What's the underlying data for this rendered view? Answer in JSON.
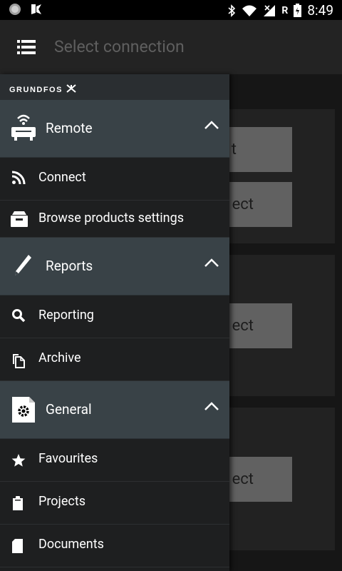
{
  "status_bar": {
    "time": "8:49",
    "network_badge": "R"
  },
  "app_bar": {
    "title": "Select connection"
  },
  "background": {
    "buttons": [
      {
        "label": "t"
      },
      {
        "label": "ect"
      },
      {
        "label": "ect"
      },
      {
        "label": "ect"
      }
    ]
  },
  "drawer": {
    "logo": "GRUNDFOS",
    "sections": [
      {
        "label": "Remote",
        "items": [
          {
            "label": "Connect",
            "icon": "rss-feed-icon"
          },
          {
            "label": "Browse products settings",
            "icon": "file-drawer-icon"
          }
        ]
      },
      {
        "label": "Reports",
        "items": [
          {
            "label": "Reporting",
            "icon": "search-icon"
          },
          {
            "label": "Archive",
            "icon": "archive-files-icon"
          }
        ]
      },
      {
        "label": "General",
        "items": [
          {
            "label": "Favourites",
            "icon": "star-icon"
          },
          {
            "label": "Projects",
            "icon": "clipboard-icon"
          },
          {
            "label": "Documents",
            "icon": "document-icon"
          }
        ]
      }
    ]
  },
  "colors": {
    "section_bg": "#394247",
    "drawer_bg": "#1e1f20",
    "app_bar_bg": "#232323"
  }
}
